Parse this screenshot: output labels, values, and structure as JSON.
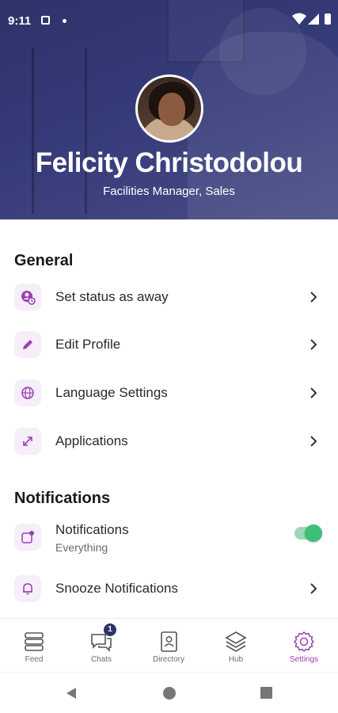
{
  "status_bar": {
    "time": "9:11"
  },
  "profile": {
    "name": "Felicity Christodolou",
    "subtitle": "Facilities Manager, Sales"
  },
  "sections": {
    "general": {
      "title": "General",
      "items": [
        {
          "label": "Set status as away",
          "icon": "status-away-icon"
        },
        {
          "label": "Edit Profile",
          "icon": "pencil-icon"
        },
        {
          "label": "Language Settings",
          "icon": "globe-icon"
        },
        {
          "label": "Applications",
          "icon": "external-link-icon"
        }
      ]
    },
    "notifications": {
      "title": "Notifications",
      "items": [
        {
          "label": "Notifications",
          "sublabel": "Everything",
          "icon": "notification-badge-icon",
          "toggle_on": true
        },
        {
          "label": "Snooze Notifications",
          "icon": "bell-icon"
        }
      ]
    }
  },
  "tabs": [
    {
      "label": "Feed",
      "icon": "feed-icon",
      "active": false
    },
    {
      "label": "Chats",
      "icon": "chat-icon",
      "badge": "1",
      "active": false
    },
    {
      "label": "Directory",
      "icon": "directory-icon",
      "active": false
    },
    {
      "label": "Hub",
      "icon": "layers-icon",
      "active": false
    },
    {
      "label": "Settings",
      "icon": "gear-icon",
      "active": true
    }
  ],
  "colors": {
    "accent": "#9c3fb3",
    "header": "#2f336a",
    "toggle_on": "#3cbf79",
    "icon_tile": "#f6eef8"
  }
}
